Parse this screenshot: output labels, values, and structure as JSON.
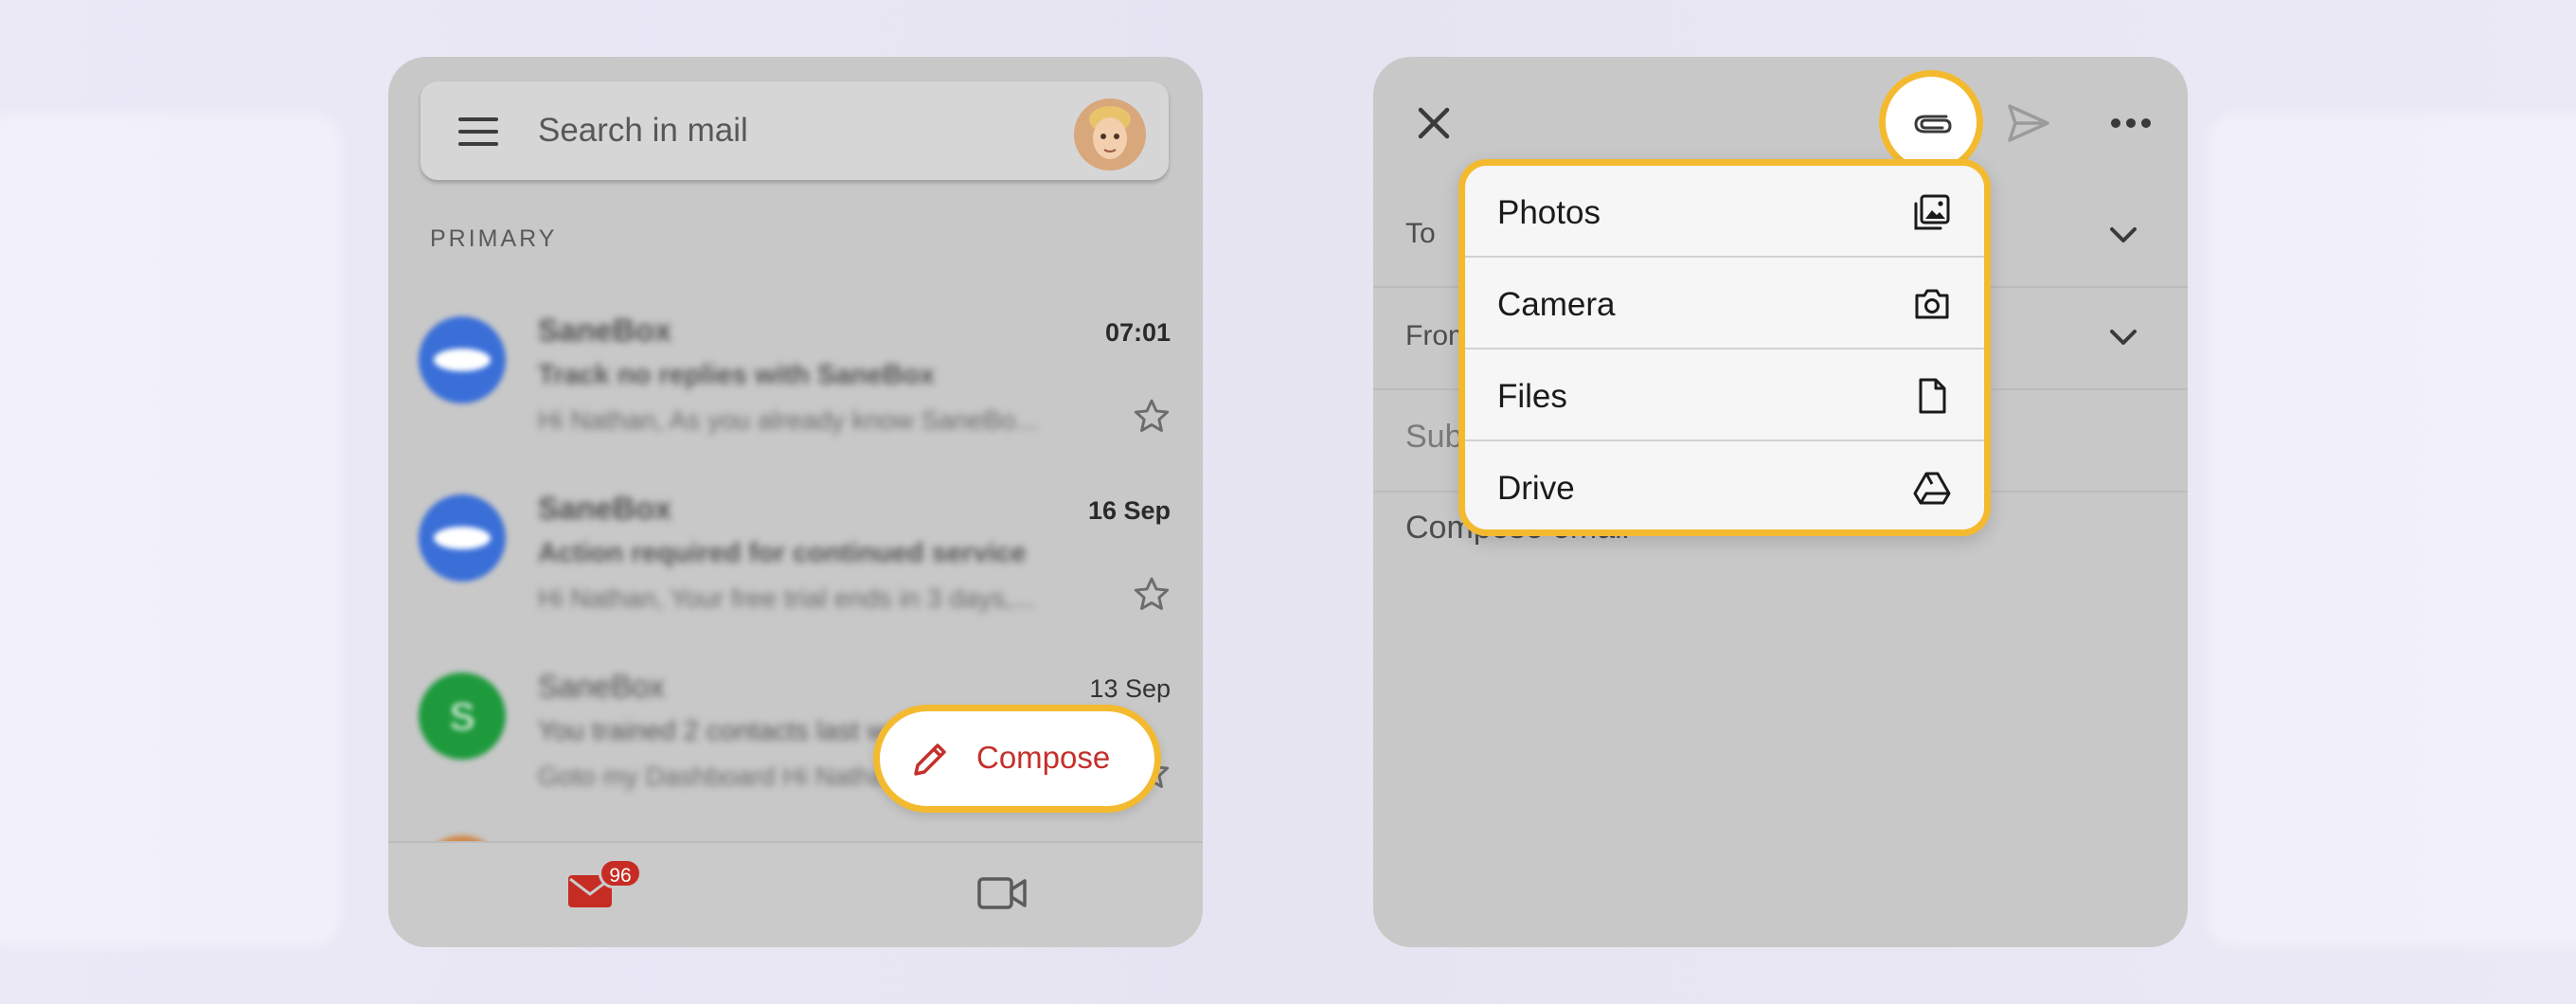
{
  "inbox": {
    "search_placeholder": "Search in mail",
    "section_label": "PRIMARY",
    "emails": [
      {
        "sender": "SaneBox",
        "subject": "Track no replies with SaneBox",
        "snippet": "Hi Nathan, As you already know SaneBo...",
        "time": "07:01",
        "unread": true,
        "avatar_color": "#3a6fd8"
      },
      {
        "sender": "SaneBox",
        "subject": "Action required for continued service",
        "snippet": "Hi Nathan, Your free trial ends in 3 days,...",
        "time": "16 Sep",
        "unread": true,
        "avatar_color": "#3a6fd8"
      },
      {
        "sender": "SaneBox",
        "subject": "You trained 2 contacts last week",
        "snippet": "Goto my Dashboard Hi Nathan...",
        "time": "13 Sep",
        "unread": false,
        "avatar_color": "#1e9a3d",
        "avatar_letter": "S"
      }
    ],
    "compose_label": "Compose",
    "mail_badge": "96"
  },
  "compose_screen": {
    "to_label": "To",
    "from_label": "From",
    "subject_placeholder": "Subject",
    "body_placeholder": "Compose email",
    "attach_menu": [
      {
        "label": "Photos",
        "icon": "photos-icon"
      },
      {
        "label": "Camera",
        "icon": "camera-icon"
      },
      {
        "label": "Files",
        "icon": "file-icon"
      },
      {
        "label": "Drive",
        "icon": "drive-icon"
      }
    ]
  },
  "colors": {
    "highlight": "#f4ba2f",
    "compose_red": "#c4302b",
    "badge_red": "#c62c23"
  }
}
